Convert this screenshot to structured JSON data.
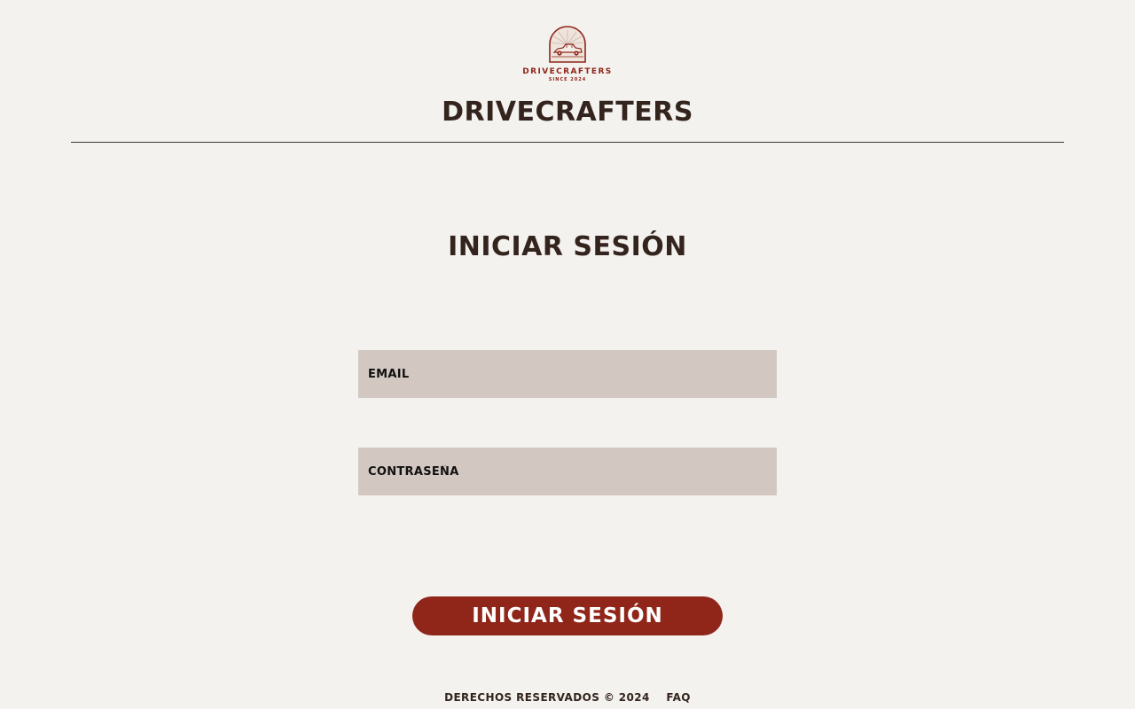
{
  "header": {
    "logo": {
      "icon": "vintage-car-logo",
      "wordmark": "DRIVECRAFTERS",
      "tagline": "SINCE 2024"
    },
    "brand": "DRIVECRAFTERS"
  },
  "main": {
    "title": "INICIAR SESIÓN",
    "email_placeholder": "EMAIL",
    "password_placeholder": "CONTRASEÑA",
    "submit_label": "INICIAR SESIÓN"
  },
  "footer": {
    "copyright": "DERECHOS RESERVADOS © 2024",
    "faq": "FAQ"
  },
  "colors": {
    "background": "#f4f2ef",
    "text": "#33241d",
    "field": "#d2c7c1",
    "accent": "#8f2619"
  }
}
